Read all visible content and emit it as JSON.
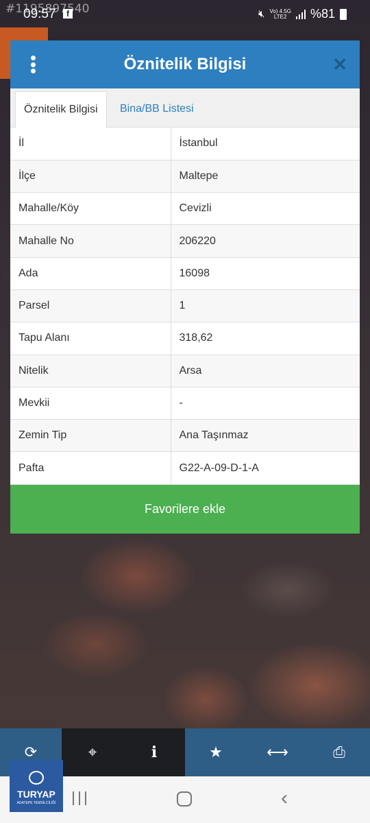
{
  "watermark": "#1195897540",
  "status_bar": {
    "time": "09:57",
    "network_top": "Vo) 4.5G",
    "network_bottom": "LTE2",
    "battery": "%81"
  },
  "dialog": {
    "title": "Öznitelik Bilgisi",
    "tabs": [
      {
        "label": "Öznitelik Bilgisi",
        "active": true
      },
      {
        "label": "Bina/BB Listesi",
        "active": false
      }
    ],
    "rows": [
      {
        "key": "İl",
        "value": "İstanbul"
      },
      {
        "key": "İlçe",
        "value": "Maltepe"
      },
      {
        "key": "Mahalle/Köy",
        "value": "Cevizli"
      },
      {
        "key": "Mahalle No",
        "value": "206220"
      },
      {
        "key": "Ada",
        "value": "16098"
      },
      {
        "key": "Parsel",
        "value": "1"
      },
      {
        "key": "Tapu Alanı",
        "value": "318,62"
      },
      {
        "key": "Nitelik",
        "value": "Arsa"
      },
      {
        "key": "Mevkii",
        "value": "-"
      },
      {
        "key": "Zemin Tip",
        "value": "Ana Taşınmaz"
      },
      {
        "key": "Pafta",
        "value": "G22-A-09-D-1-A"
      }
    ],
    "favorite_button": "Favorilere ekle"
  },
  "toolbar": {
    "icons": [
      "refresh-icon",
      "locate-icon",
      "info-icon",
      "star-icon",
      "measure-icon",
      "print-icon"
    ]
  },
  "logo": {
    "name": "TURYAP",
    "subtitle": "ADATEPE TEMSİLCİLİĞİ"
  },
  "colors": {
    "header_blue": "#2e7fbf",
    "button_green": "#4caf50",
    "toolbar_blue": "#2e5d86"
  }
}
